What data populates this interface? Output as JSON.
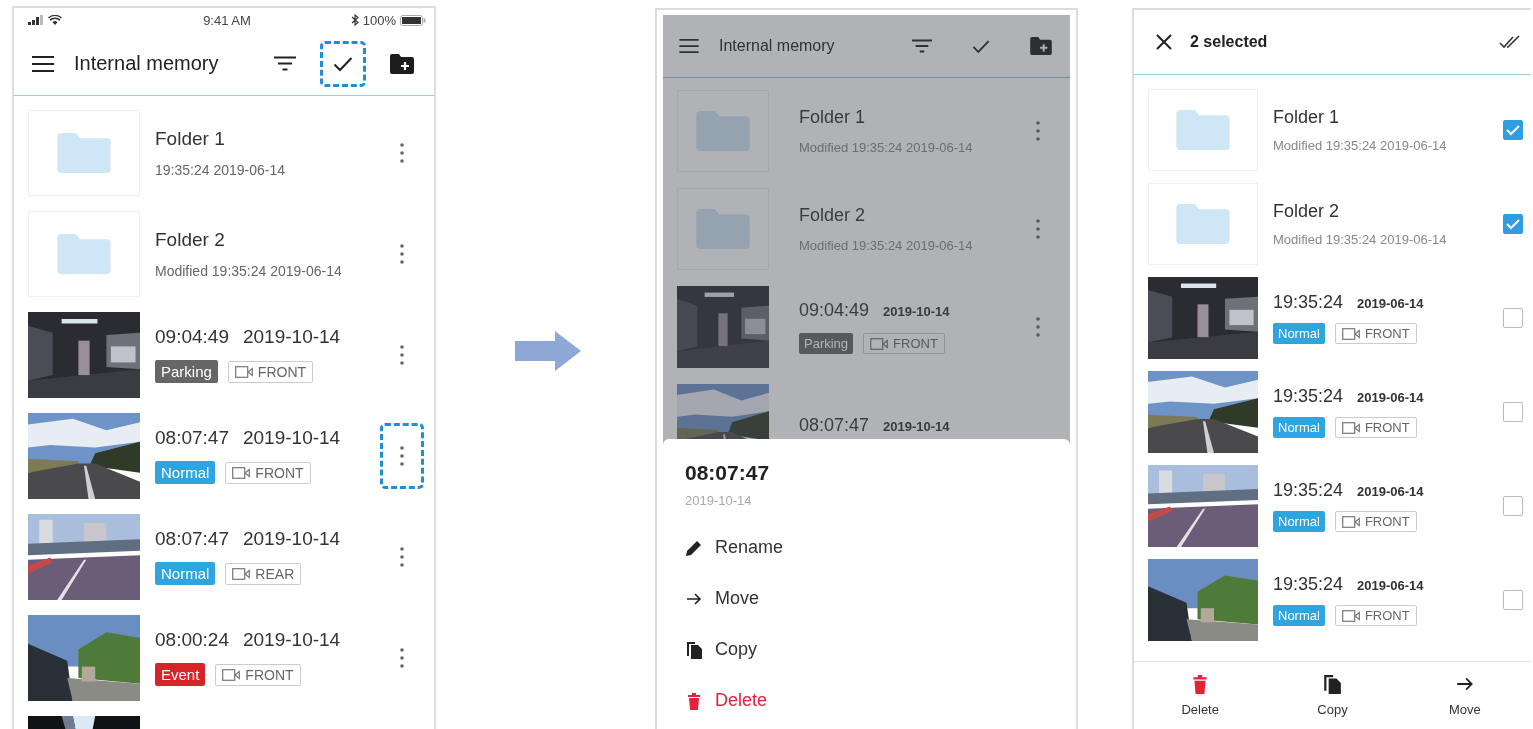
{
  "list_screen": {
    "status_bar": {
      "time": "9:41 AM",
      "battery": "100%"
    },
    "title": "Internal memory",
    "select_highlighted": true,
    "items": [
      {
        "kind": "folder",
        "name": "Folder 1",
        "detail": "19:35:24 2019-06-14",
        "menu_highlighted": false
      },
      {
        "kind": "folder",
        "name": "Folder 2",
        "detail": "Modified 19:35:24 2019-06-14",
        "menu_highlighted": false
      },
      {
        "kind": "video",
        "time": "09:04:49",
        "date": "2019-10-14",
        "tag": {
          "label": "Parking",
          "color": "#666666"
        },
        "camera": "FRONT",
        "menu_highlighted": false
      },
      {
        "kind": "video",
        "time": "08:07:47",
        "date": "2019-10-14",
        "tag": {
          "label": "Normal",
          "color": "#2fa5e0"
        },
        "camera": "FRONT",
        "menu_highlighted": true
      },
      {
        "kind": "video",
        "time": "08:07:47",
        "date": "2019-10-14",
        "tag": {
          "label": "Normal",
          "color": "#2fa5e0"
        },
        "camera": "REAR",
        "menu_highlighted": false
      },
      {
        "kind": "video",
        "time": "08:00:24",
        "date": "2019-10-14",
        "tag": {
          "label": "Event",
          "color": "#d7232a"
        },
        "camera": "FRONT",
        "menu_highlighted": false
      },
      {
        "kind": "picture"
      }
    ]
  },
  "menu_screen": {
    "title": "Internal memory",
    "items": [
      {
        "kind": "folder",
        "name": "Folder 1",
        "detail": "Modified 19:35:24 2019-06-14"
      },
      {
        "kind": "folder",
        "name": "Folder 2",
        "detail": "Modified 19:35:24 2019-06-14"
      },
      {
        "kind": "video",
        "time": "09:04:49",
        "date": "2019-10-14",
        "tag": {
          "label": "Parking",
          "color": "#666666"
        },
        "camera": "FRONT"
      },
      {
        "kind": "video",
        "time": "08:07:47",
        "date": "2019-10-14"
      }
    ],
    "sheet": {
      "title": "08:07:47",
      "subtitle": "2019-10-14",
      "actions": [
        {
          "kind": "rename",
          "label": "Rename"
        },
        {
          "kind": "move",
          "label": "Move"
        },
        {
          "kind": "copy",
          "label": "Copy"
        },
        {
          "kind": "delete",
          "label": "Delete"
        }
      ]
    }
  },
  "select_screen": {
    "title": "2 selected",
    "items": [
      {
        "kind": "folder",
        "name": "Folder 1",
        "detail": "Modified 19:35:24 2019-06-14",
        "checked": true
      },
      {
        "kind": "folder",
        "name": "Folder 2",
        "detail": "Modified 19:35:24 2019-06-14",
        "checked": true
      },
      {
        "kind": "video",
        "time": "19:35:24",
        "date": "2019-06-14",
        "tag": {
          "label": "Normal",
          "color": "#2fa5e0"
        },
        "camera": "FRONT",
        "checked": false
      },
      {
        "kind": "video",
        "time": "19:35:24",
        "date": "2019-06-14",
        "tag": {
          "label": "Normal",
          "color": "#2fa5e0"
        },
        "camera": "FRONT",
        "checked": false
      },
      {
        "kind": "video",
        "time": "19:35:24",
        "date": "2019-06-14",
        "tag": {
          "label": "Normal",
          "color": "#2fa5e0"
        },
        "camera": "FRONT",
        "checked": false
      },
      {
        "kind": "video",
        "time": "19:35:24",
        "date": "2019-06-14",
        "tag": {
          "label": "Normal",
          "color": "#2fa5e0"
        },
        "camera": "FRONT",
        "checked": false
      }
    ],
    "actions": [
      {
        "kind": "delete",
        "label": "Delete"
      },
      {
        "kind": "copy",
        "label": "Copy"
      },
      {
        "kind": "move",
        "label": "Move"
      }
    ]
  }
}
